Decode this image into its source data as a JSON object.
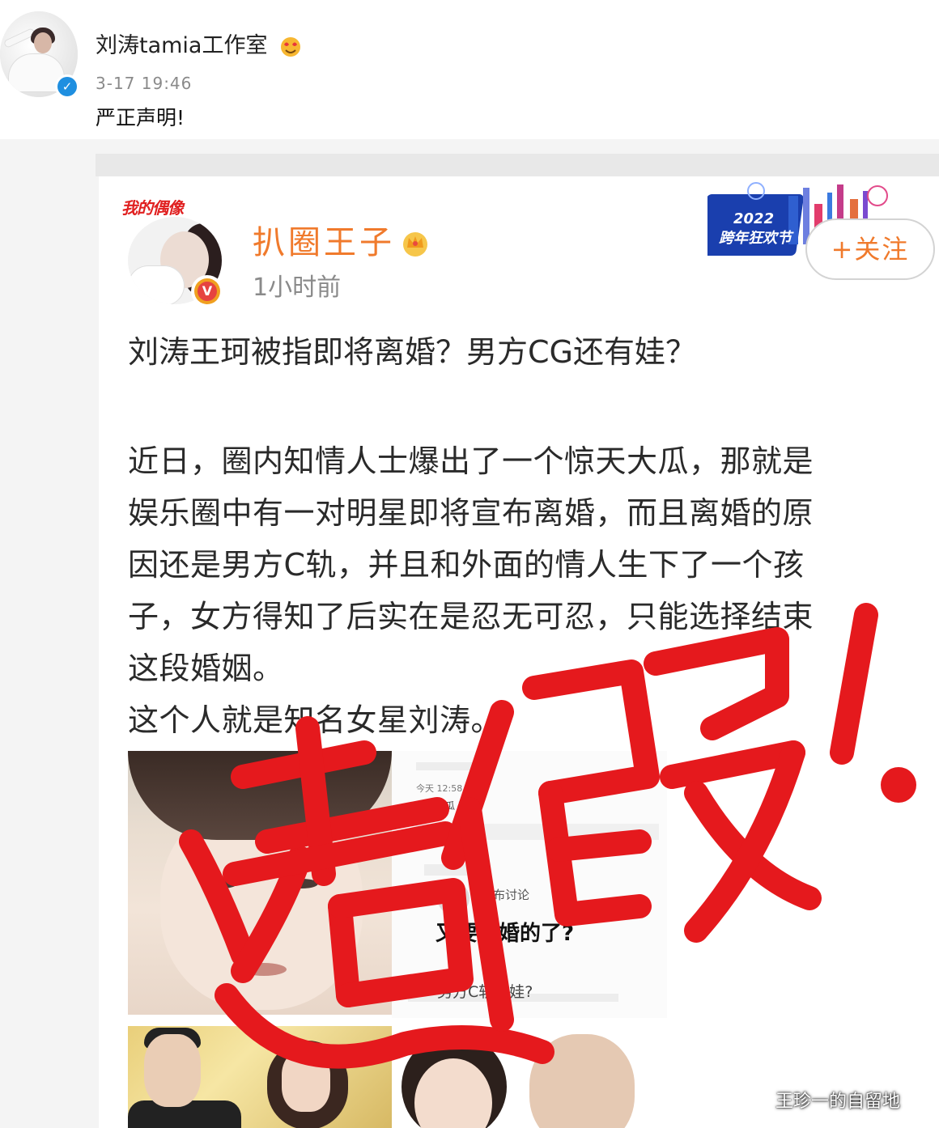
{
  "studio_post": {
    "author": "刘涛tamia工作室",
    "time": "3-17 19:46",
    "text": "严正声明!"
  },
  "reposted_card": {
    "stamp_text": "我的偶像",
    "author": "扒圈王子",
    "time": "1小时前",
    "banner_year": "2022",
    "banner_text": "跨年狂欢节",
    "follow_label": "+关注",
    "headline": "刘涛王珂被指即将离婚？男方CG还有娃？",
    "body_lines": [
      "近日，圈内知情人士爆出了一个惊天大瓜，那就是",
      "娱乐圈中有一对明星即将宣布离婚，而且离婚的原",
      "因还是男方C轨，并且和外面的情人生下了一个孩",
      "子，女方得知了后实在是忍无可忍，只能选择结束",
      "这段婚姻。",
      "这个人就是知名女星刘涛。"
    ],
    "screenshot": {
      "time": "今天 12:58",
      "line": "听的道瓜 真了",
      "discuss": "发布讨论",
      "title": "又要离婚的了?",
      "subtitle": "男方C轨有娃?"
    }
  },
  "overlay": {
    "stamp": "造假！",
    "color": "#e5191d"
  },
  "watermark": "王珍一的自留地"
}
